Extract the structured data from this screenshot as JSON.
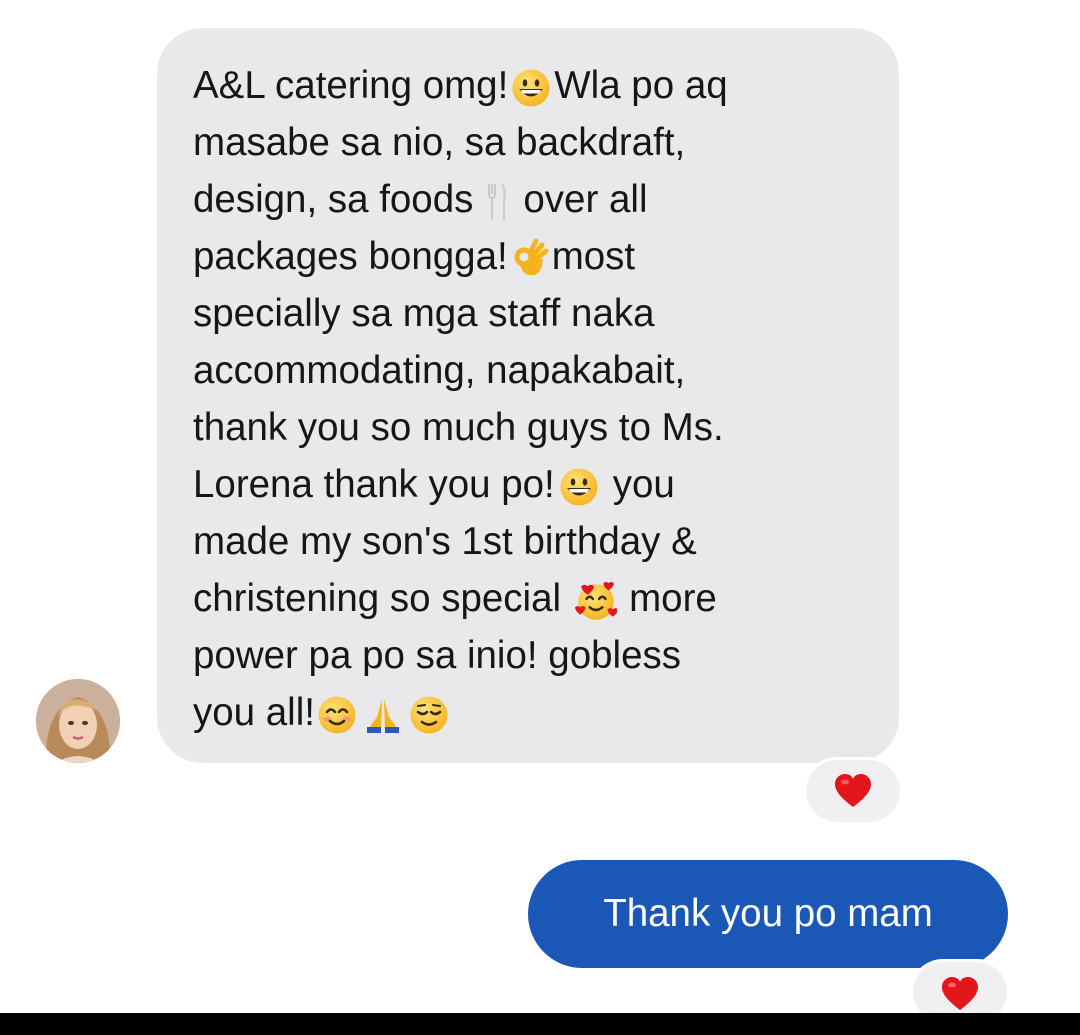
{
  "conversation": {
    "incoming": {
      "lines": [
        "A&L catering omg!",
        "Wla po aq",
        "masabe sa nio, sa backdraft,",
        "design, sa foods",
        "over all",
        "packages bongga!",
        "most",
        "specially sa mga staff naka",
        "accommodating, napakabait,",
        "thank you so much guys to Ms.",
        "Lorena thank you po!",
        "you",
        "made my son's 1st birthday &",
        "christening so special",
        "more",
        "power pa po sa inio! gobless",
        "you all!"
      ],
      "emojis": [
        "grinning-face",
        "fork-and-knife",
        "ok-hand",
        "grinning-face",
        "smiling-face-with-hearts",
        "smiling-face-with-smiling-eyes",
        "folded-hands",
        "relieved-face"
      ],
      "reaction": "red-heart",
      "avatar": "sender-profile-photo"
    },
    "outgoing": {
      "text": "Thank you po mam",
      "bubble_color": "#1a57b6",
      "reaction": "red-heart"
    },
    "colors": {
      "incoming_bubble": "#e9e9eb",
      "heart": "#e3161b"
    }
  }
}
